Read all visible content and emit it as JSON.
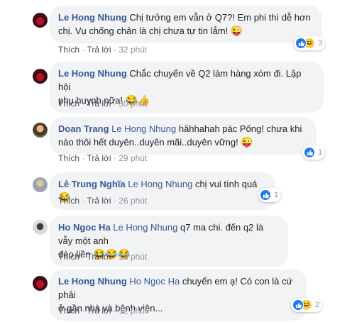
{
  "comments": [
    {
      "author": "Le Hong Nhung",
      "tag": "",
      "text_line1": "Chị tưởng em vẫn ở Q7?! Em phi thì dễ hơn",
      "text_line2": "chị. Vụ chống chân là chị chưa tự tin lắm!",
      "emoji": "😜",
      "like_label": "Thích",
      "reply_label": "Trả lời",
      "time": "32 phút",
      "reaction_count": "3"
    },
    {
      "author": "Le Hong Nhung",
      "tag": "",
      "text_line1": "Chắc chuyển về Q2 làm hàng xóm đi. Lập hội",
      "text_line2": "phụ huynh nữa!",
      "emoji": "😂👍",
      "like_label": "Thích",
      "reply_label": "Trả lời",
      "time": "30 phút"
    },
    {
      "author": "Doan Trang",
      "tag": "Le Hong Nhung",
      "text_line1": "hâhhahah pác Pống! chưa khi",
      "text_line2": "nào thôi hết duyên..duyên mãi..duyên vững!",
      "emoji": "😜",
      "like_label": "Thích",
      "reply_label": "Trả lời",
      "time": "29 phút",
      "reaction_count": "1"
    },
    {
      "author": "Lê Trung Nghĩa",
      "tag": "Le Hong Nhung",
      "text_line1": "chị vui tính quá",
      "emoji": "😂",
      "like_label": "Thích",
      "reply_label": "Trả lời",
      "time": "26 phút",
      "reaction_count": "1"
    },
    {
      "author": "Ho Ngoc Ha",
      "tag": "Le Hong Nhung",
      "text_line1": "q7 ma chi. đến q2 là vẫy một anh",
      "text_line2": "đèo liền",
      "emoji": "😂😂😂",
      "like_label": "Thích",
      "reply_label": "Trả lời",
      "time": "16 phút"
    },
    {
      "author": "Le Hong Nhung",
      "tag": "Ho Ngoc Ha",
      "text_line1": "chuyển em ạ! Có con là cứ phải",
      "text_line2": "ở gần nhà và bệnh viện...",
      "like_label": "Thích",
      "reply_label": "Trả lời",
      "time": "12 phút",
      "reaction_count": "2"
    }
  ],
  "colors": {
    "name": "#385898",
    "bubble": "#f2f3f5",
    "meta": "#90949c",
    "like": "#2078f4",
    "haha": "#fcd040"
  },
  "icons": {
    "like": "like-icon",
    "haha": "haha-icon"
  }
}
